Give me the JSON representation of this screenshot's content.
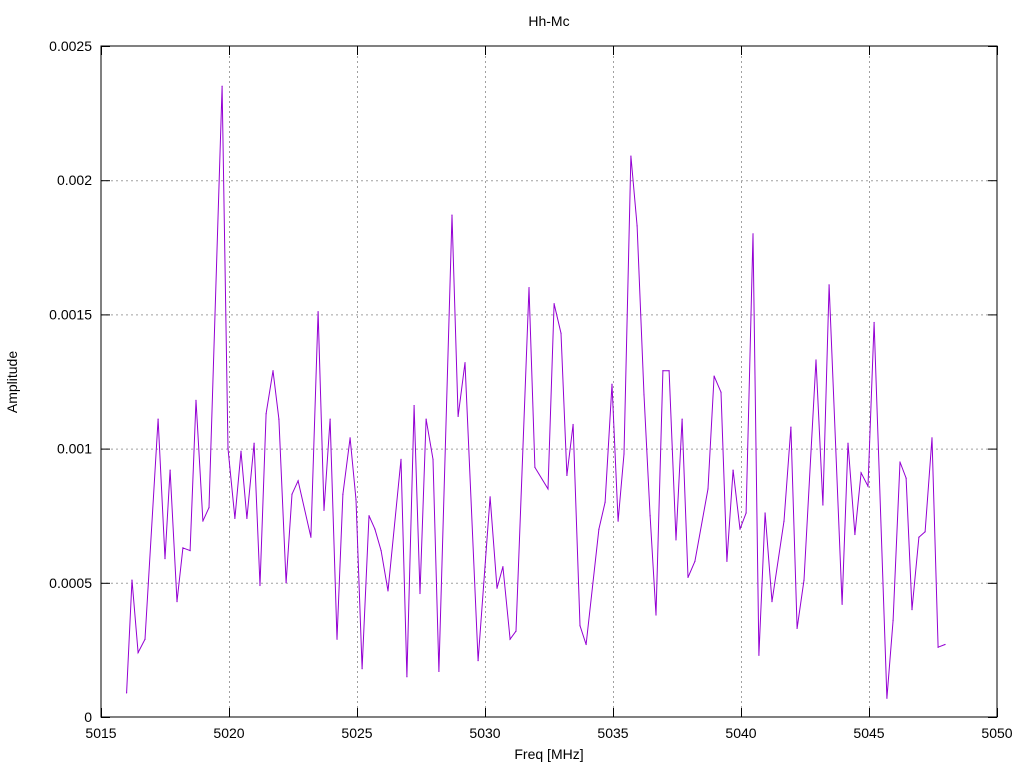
{
  "chart_data": {
    "type": "line",
    "title": "Hh-Mc",
    "xlabel": "Freq [MHz]",
    "ylabel": "Amplitude",
    "xlim": [
      5015,
      5050
    ],
    "ylim": [
      0,
      0.0025
    ],
    "grid": true,
    "line_color": "#9400d3",
    "x_ticks": [
      "5015",
      "5020",
      "5025",
      "5030",
      "5035",
      "5040",
      "5045",
      "5050"
    ],
    "x_tick_values": [
      5015,
      5020,
      5025,
      5030,
      5035,
      5040,
      5045,
      5050
    ],
    "y_ticks": [
      "0",
      "0.0005",
      "0.001",
      "0.0015",
      "0.002",
      "0.0025"
    ],
    "y_tick_values": [
      0,
      0.0005,
      0.001,
      0.0015,
      0.002,
      0.0025
    ],
    "series": [
      {
        "name": "Hh-Mc",
        "x": [
          5016.0,
          5016.21,
          5016.45,
          5016.72,
          5017.23,
          5017.5,
          5017.7,
          5017.97,
          5018.2,
          5018.48,
          5018.71,
          5018.98,
          5019.22,
          5019.73,
          5019.96,
          5020.23,
          5020.47,
          5020.7,
          5020.98,
          5021.21,
          5021.45,
          5021.72,
          5021.95,
          5022.23,
          5022.46,
          5022.7,
          5023.2,
          5023.48,
          5023.71,
          5023.95,
          5024.22,
          5024.45,
          5024.73,
          5024.96,
          5025.2,
          5025.47,
          5025.7,
          5025.94,
          5026.21,
          5026.72,
          5026.95,
          5027.23,
          5027.46,
          5027.7,
          5027.97,
          5028.2,
          5028.71,
          5028.95,
          5029.22,
          5029.73,
          5030.2,
          5030.47,
          5030.7,
          5030.98,
          5031.21,
          5031.72,
          5031.95,
          5032.46,
          5032.7,
          5032.97,
          5033.2,
          5033.44,
          5033.71,
          5033.95,
          5034.45,
          5034.69,
          5034.96,
          5035.2,
          5035.43,
          5035.7,
          5035.94,
          5036.21,
          5036.45,
          5036.68,
          5036.95,
          5037.19,
          5037.46,
          5037.7,
          5037.93,
          5038.2,
          5038.71,
          5038.95,
          5039.22,
          5039.45,
          5039.69,
          5039.96,
          5040.2,
          5040.47,
          5040.7,
          5040.94,
          5041.21,
          5041.68,
          5041.95,
          5042.19,
          5042.46,
          5042.93,
          5043.2,
          5043.44,
          5043.95,
          5044.18,
          5044.45,
          5044.69,
          5044.96,
          5045.2,
          5045.7,
          5045.94,
          5046.21,
          5046.45,
          5046.68,
          5046.95,
          5047.19,
          5047.46,
          5047.7,
          5047.97
        ],
        "y": [
          9e-05,
          0.00051,
          0.00024,
          0.00029,
          0.00111,
          0.00059,
          0.00092,
          0.00043,
          0.00063,
          0.00062,
          0.00118,
          0.00073,
          0.00078,
          0.00235,
          0.001,
          0.00074,
          0.00099,
          0.00074,
          0.00102,
          0.00049,
          0.00113,
          0.00129,
          0.00111,
          0.0005,
          0.00083,
          0.00088,
          0.00067,
          0.00151,
          0.00077,
          0.00111,
          0.00029,
          0.00083,
          0.00104,
          0.00081,
          0.00018,
          0.00075,
          0.0007,
          0.00062,
          0.00047,
          0.00096,
          0.00015,
          0.00116,
          0.00046,
          0.00111,
          0.00096,
          0.00017,
          0.00187,
          0.00112,
          0.00132,
          0.00021,
          0.00082,
          0.00048,
          0.00056,
          0.00029,
          0.00032,
          0.0016,
          0.00093,
          0.00085,
          0.00154,
          0.00143,
          0.0009,
          0.00109,
          0.00034,
          0.00027,
          0.0007,
          0.0008,
          0.00124,
          0.00073,
          0.00098,
          0.00209,
          0.00183,
          0.0012,
          0.00075,
          0.00038,
          0.00129,
          0.00129,
          0.00066,
          0.00111,
          0.00052,
          0.00058,
          0.00085,
          0.00127,
          0.00121,
          0.00058,
          0.00092,
          0.0007,
          0.00076,
          0.0018,
          0.00023,
          0.00076,
          0.00043,
          0.00073,
          0.00108,
          0.00033,
          0.00051,
          0.00133,
          0.00079,
          0.00161,
          0.00042,
          0.00102,
          0.00068,
          0.00091,
          0.00086,
          0.00147,
          7e-05,
          0.00036,
          0.00095,
          0.00089,
          0.0004,
          0.00067,
          0.00069,
          0.00104,
          0.00026,
          0.00027
        ]
      }
    ]
  }
}
